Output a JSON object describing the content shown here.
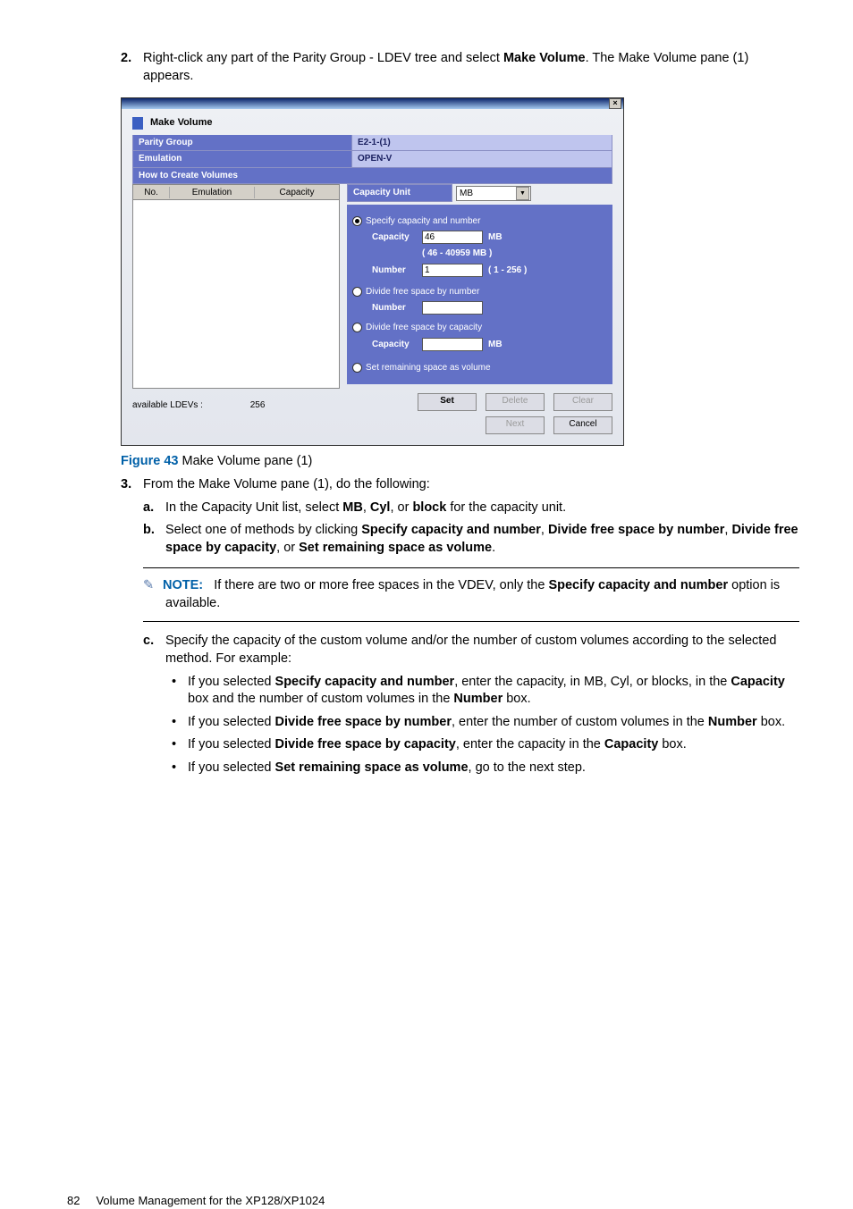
{
  "step2": {
    "marker": "2.",
    "text_a": "Right-click any part of the Parity Group - LDEV tree and select ",
    "bold_a": "Make Volume",
    "text_b": ". The Make Volume pane (1) appears."
  },
  "screenshot": {
    "title": "Make Volume",
    "parity_label": "Parity Group",
    "parity_val": "E2-1-(1)",
    "emu_label": "Emulation",
    "emu_val": "OPEN-V",
    "section": "How to Create Volumes",
    "cols": {
      "c1": "No.",
      "c2": "Emulation",
      "c3": "Capacity"
    },
    "avail_label": "available LDEVs :",
    "avail_val": "256",
    "cap_unit_label": "Capacity Unit",
    "cap_unit_val": "MB",
    "opt1": "Specify capacity and number",
    "cap_label": "Capacity",
    "cap_val": "46",
    "cap_unit": "MB",
    "cap_range": "( 46 - 40959 MB )",
    "num_label": "Number",
    "num_val": "1",
    "num_range": "( 1 - 256 )",
    "opt2": "Divide free space by  number",
    "num2_label": "Number",
    "opt3": "Divide free space by capacity",
    "cap2_label": "Capacity",
    "cap2_unit": "MB",
    "opt4": "Set remaining space as volume",
    "btns": {
      "set": "Set",
      "delete": "Delete",
      "clear": "Clear",
      "next": "Next",
      "cancel": "Cancel"
    }
  },
  "figcap": {
    "label": "Figure 43",
    "text": "Make Volume pane (1)"
  },
  "step3": {
    "marker": "3.",
    "text": "From the Make Volume pane (1), do the following:",
    "a": {
      "marker": "a.",
      "t1": "In the Capacity Unit list, select ",
      "b1": "MB",
      "t2": ", ",
      "b2": "Cyl",
      "t3": ", or ",
      "b3": "block",
      "t4": " for the capacity unit."
    },
    "b": {
      "marker": "b.",
      "t1": "Select one of methods by clicking ",
      "b1": "Specify capacity and number",
      "t2": ", ",
      "b2": "Divide free space by number",
      "t3": ", ",
      "b3": "Divide free space by capacity",
      "t4": ", or ",
      "b4": "Set remaining space as volume",
      "t5": "."
    },
    "note": {
      "label": "NOTE:",
      "t1": "If there are two or more free spaces in the VDEV, only the ",
      "b1": "Specify capacity and number",
      "t2": " option is available."
    },
    "c": {
      "marker": "c.",
      "text": "Specify the capacity of the custom volume and/or the number of custom volumes according to the selected method. For example:"
    },
    "bul1": {
      "t1": "If you selected ",
      "b1": "Specify capacity and number",
      "t2": ", enter the capacity, in MB, Cyl, or blocks, in the ",
      "b2": "Capacity",
      "t3": " box and the number of custom volumes in the ",
      "b3": "Number",
      "t4": " box."
    },
    "bul2": {
      "t1": "If you selected ",
      "b1": "Divide free space by number",
      "t2": ", enter the number of custom volumes in the ",
      "b2": "Number",
      "t3": " box."
    },
    "bul3": {
      "t1": "If you selected ",
      "b1": "Divide free space by capacity",
      "t2": ", enter the capacity in the ",
      "b2": "Capacity",
      "t3": " box."
    },
    "bul4": {
      "t1": "If you selected ",
      "b1": "Set remaining space as volume",
      "t2": ", go to the next step."
    }
  },
  "footer": {
    "page": "82",
    "title": "Volume Management for the XP128/XP1024"
  }
}
